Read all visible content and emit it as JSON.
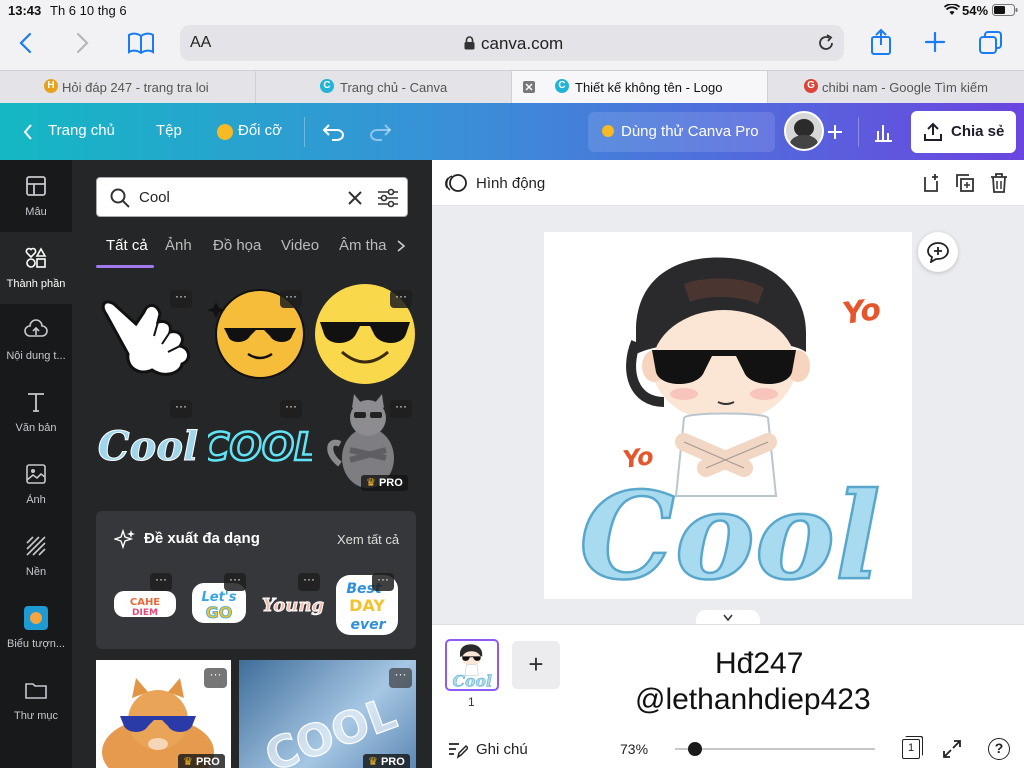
{
  "status_bar": {
    "time": "13:43",
    "date": "Th 6 10 thg 6",
    "battery": "54%"
  },
  "browser": {
    "text_size_label": "AA",
    "url": "canva.com",
    "tabs": [
      {
        "label": "Hỏi đáp 247 - trang tra loi",
        "favicon": "H",
        "color": "#e6a21a"
      },
      {
        "label": "Trang chủ - Canva",
        "favicon": "C",
        "color": "#22b3d6"
      },
      {
        "label": "Thiết kế không tên - Logo",
        "favicon": "C",
        "color": "#22b3d6",
        "active": true
      },
      {
        "label": "chibi nam - Google Tìm kiếm",
        "favicon": "G",
        "color": "#db4437"
      }
    ]
  },
  "header": {
    "home": "Trang chủ",
    "file": "Tệp",
    "resize": "Đổi cỡ",
    "pro_trial": "Dùng thử Canva Pro",
    "share": "Chia sẻ"
  },
  "rail": [
    {
      "label": "Mẫu",
      "icon": "template-icon"
    },
    {
      "label": "Thành phần",
      "icon": "elements-icon",
      "active": true
    },
    {
      "label": "Nội dung t...",
      "icon": "upload-icon"
    },
    {
      "label": "Văn bản",
      "icon": "text-icon"
    },
    {
      "label": "Ảnh",
      "icon": "photo-icon"
    },
    {
      "label": "Nền",
      "icon": "background-icon"
    },
    {
      "label": "Biểu tượn...",
      "icon": "logo-icon"
    },
    {
      "label": "Thư mục",
      "icon": "folder-icon"
    }
  ],
  "panel": {
    "search_value": "Cool",
    "categories": [
      "Tất cả",
      "Ảnh",
      "Đồ họa",
      "Video",
      "Âm tha"
    ],
    "pro_badge": "PRO",
    "suggest_title": "Đề xuất đa dạng",
    "suggest_all": "Xem tất cả",
    "sticker_cool_text": "Cool",
    "sticker_neon_text": "COOL",
    "mini_stickers": [
      "CAHE DIEM",
      "Let's GO",
      "Young",
      "Best DAY ever"
    ]
  },
  "editor": {
    "animate": "Hình động",
    "sticker_yo": "Yo",
    "sticker_cool": "Cool"
  },
  "footer": {
    "page_number": "1",
    "watermark_line1": "Hđ247",
    "watermark_line2": "@lethanhdiep423",
    "notes": "Ghi chú",
    "zoom": "73%",
    "zoom_level": 0.1,
    "page_count": "1"
  },
  "colors": {
    "header_gradient_start": "#14b8c4",
    "header_gradient_end": "#6b45e0",
    "rail_bg": "#18191b",
    "panel_bg": "#252627",
    "accent": "#a17af0",
    "safari_blue": "#1a7cf3"
  }
}
